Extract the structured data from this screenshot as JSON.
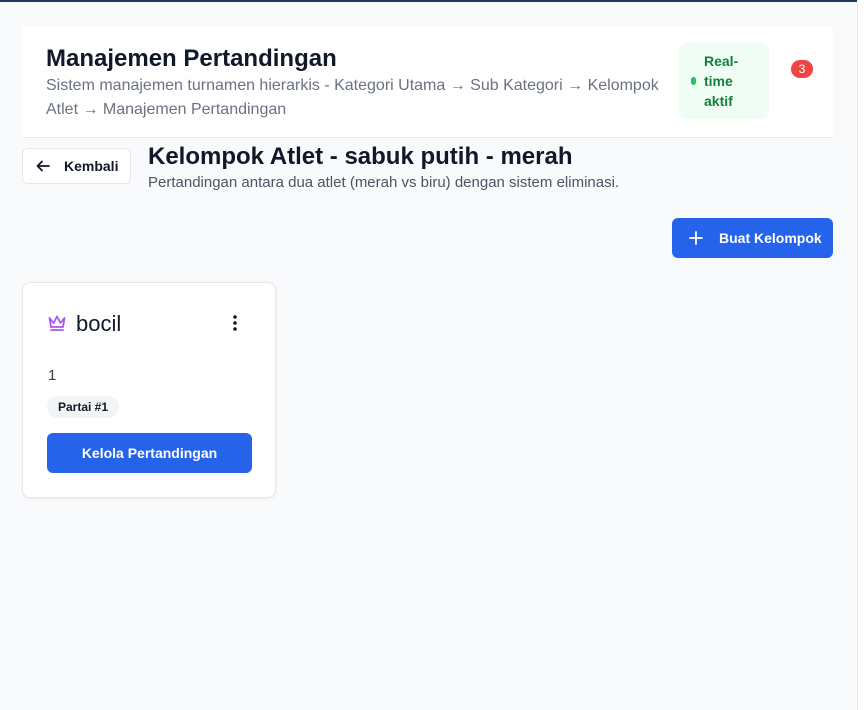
{
  "header": {
    "title": "Manajemen Pertandingan",
    "subtitle": "Sistem manajemen turnamen hierarkis - Kategori Utama → Sub Kategori → Kelompok Atlet → Manajemen Pertandingan",
    "realtime_label": "Real-time aktif",
    "notification_count": "3"
  },
  "section": {
    "back_label": "Kembali",
    "title": "Kelompok Atlet - sabuk putih - merah",
    "subtitle": "Pertandingan antara dua atlet (merah vs biru) dengan sistem eliminasi.",
    "create_label": "Buat Kelompok"
  },
  "groups": [
    {
      "name": "bocil",
      "count": "1",
      "match_badge": "Partai #1",
      "action_label": "Kelola Pertandingan",
      "icon": "crown-icon"
    }
  ],
  "colors": {
    "primary": "#2563eb",
    "success_bg": "#f0fdf4",
    "success_text": "#15803d",
    "danger": "#ef4444",
    "crown": "#a855f7"
  }
}
